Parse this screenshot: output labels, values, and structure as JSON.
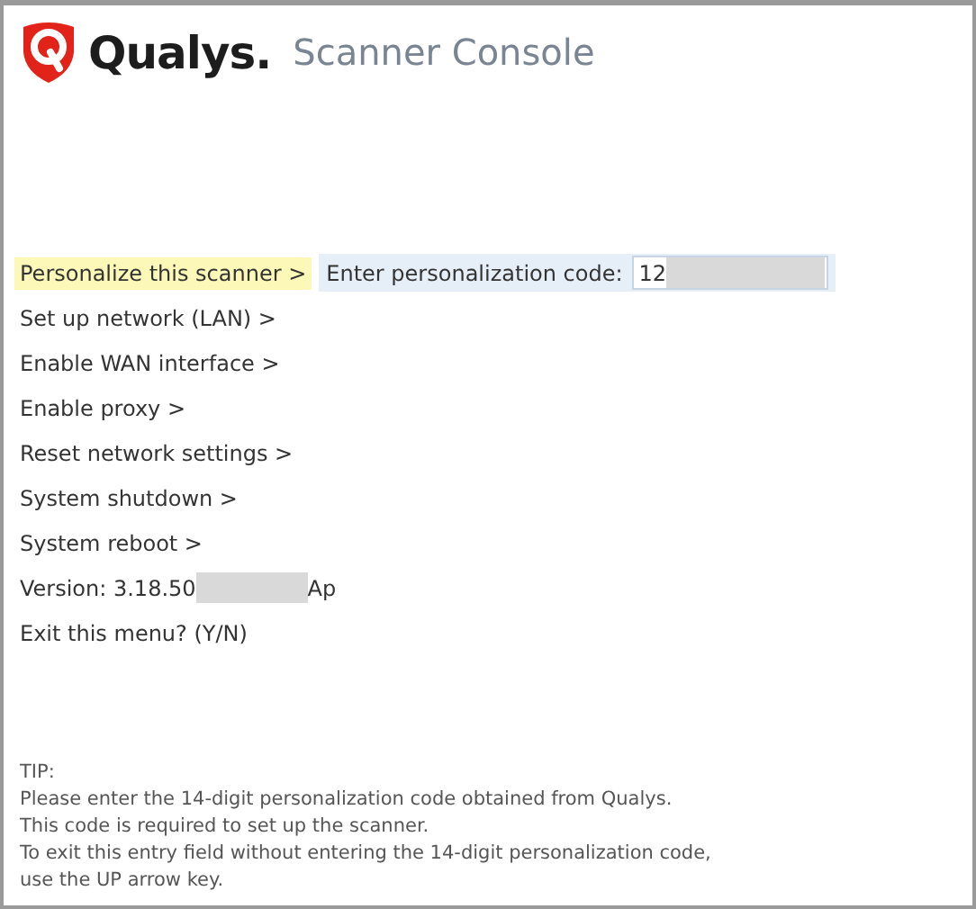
{
  "header": {
    "brand": "Qualys.",
    "product": "Scanner Console"
  },
  "menu": [
    {
      "label": "Personalize this scanner >",
      "selected": true
    },
    {
      "label": "Set up network (LAN) >",
      "selected": false
    },
    {
      "label": "Enable WAN interface >",
      "selected": false
    },
    {
      "label": "Enable proxy >",
      "selected": false
    },
    {
      "label": "Reset network settings >",
      "selected": false
    },
    {
      "label": "System shutdown >",
      "selected": false
    },
    {
      "label": "System reboot >",
      "selected": false
    }
  ],
  "prompt": {
    "label": "Enter personalization code:",
    "value": "12"
  },
  "version": {
    "before": "Version: 3.18.50",
    "after": "Ap"
  },
  "exit": "Exit this menu? (Y/N)",
  "tip": [
    "TIP:",
    "Please enter the 14-digit personalization code obtained from Qualys.",
    "This code is required to set up the scanner.",
    "To exit this entry field without entering the 14-digit personalization code,",
    "use the UP arrow key."
  ]
}
